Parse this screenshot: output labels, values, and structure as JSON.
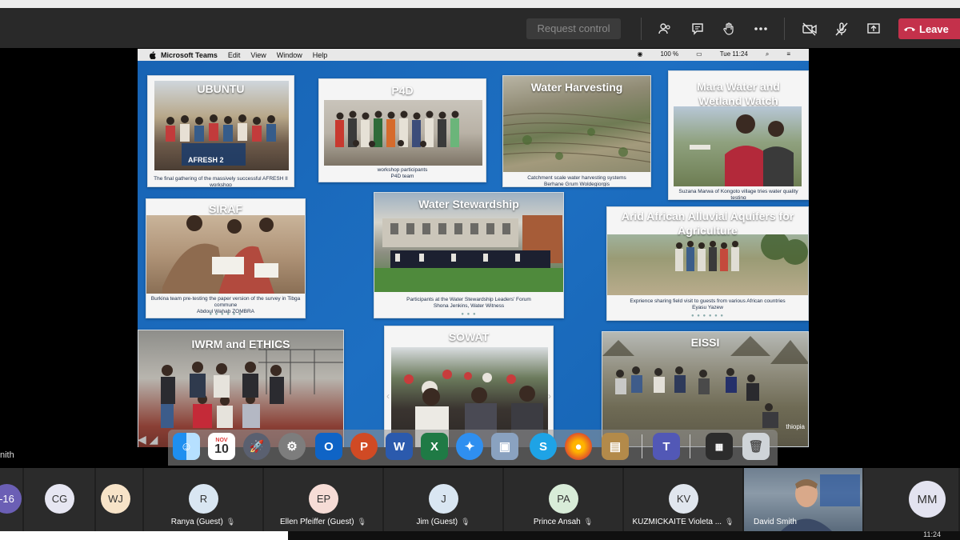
{
  "toolbar": {
    "request_control": "Request control",
    "leave": "Leave",
    "icons": [
      "participants-icon",
      "chat-icon",
      "raise-hand-icon",
      "more-icon",
      "camera-off-icon",
      "mic-off-icon",
      "share-icon"
    ]
  },
  "mac_menu": {
    "app": "Microsoft Teams",
    "items": [
      "Edit",
      "View",
      "Window",
      "Help"
    ],
    "battery": "100 %",
    "clock": "Tue 11:24"
  },
  "slide": {
    "cards": [
      {
        "title": "UBUNTU",
        "caption": "The final gathering of the massively successful AFRESH II workshop",
        "badge": "AFRESH 2"
      },
      {
        "title": "P4D",
        "caption": "workshop participants\nP4D team"
      },
      {
        "title": "Water Harvesting",
        "caption": "Catchment scale water harvesting systems\nBerhane Grum Woldegiorgis"
      },
      {
        "title": "Mara Water and Wetland Watch",
        "caption": "Suzana Marwa of Kongoto village tries water quality testing"
      },
      {
        "title": "SIRAF",
        "caption": "Burkina team pre-testing the paper version of the survey in Tibga commune\nAbdoul Wahab ZOMBRA"
      },
      {
        "title": "Water Stewardship",
        "caption": "Participants at the Water Stewardship Leaders' Forum\nShona Jenkins, Water Witness"
      },
      {
        "title": "Arid African Alluvial Aquifers for Agriculture",
        "caption": "Exprience sharing field visit to guests from various African countries\nEyasu Yazew"
      },
      {
        "title": "IWRM and ETHICS",
        "caption": ""
      },
      {
        "title": "SOWAT",
        "caption": ""
      },
      {
        "title": "EISSI",
        "caption": "thiopia"
      }
    ]
  },
  "dock": {
    "calendar_month": "NOV",
    "calendar_day": "10",
    "apps": [
      "finder-icon",
      "calendar-icon",
      "launchpad-icon",
      "system-preferences-icon",
      "outlook-icon",
      "powerpoint-icon",
      "word-icon",
      "excel-icon",
      "safari-icon",
      "preview-icon",
      "skype-icon",
      "firefox-icon",
      "notes-icon",
      "teams-icon",
      "control-strip-icon",
      "trash-icon"
    ]
  },
  "presenter_label": "nith",
  "participants": [
    {
      "initials": "-16",
      "name": "",
      "color": "#6b5fb5"
    },
    {
      "initials": "CG",
      "name": "",
      "color": "#e6e6f2"
    },
    {
      "initials": "WJ",
      "name": "",
      "color": "#f7e3c8"
    },
    {
      "initials": "R",
      "name": "Ranya (Guest)",
      "color": "#d9e6f2"
    },
    {
      "initials": "EP",
      "name": "Ellen Pfeiffer (Guest)",
      "color": "#f6dcd6"
    },
    {
      "initials": "J",
      "name": "Jim (Guest)",
      "color": "#d9e6f2"
    },
    {
      "initials": "PA",
      "name": "Prince Ansah",
      "color": "#d8ecd8"
    },
    {
      "initials": "KV",
      "name": "KUZMICKAITE Violeta ...",
      "color": "#e0e6ee"
    },
    {
      "initials": "",
      "name": "David Smith",
      "color": ""
    },
    {
      "initials": "MM",
      "name": "",
      "color": "#e3e3f0"
    }
  ],
  "taskbar": {
    "clock": "11:24"
  }
}
